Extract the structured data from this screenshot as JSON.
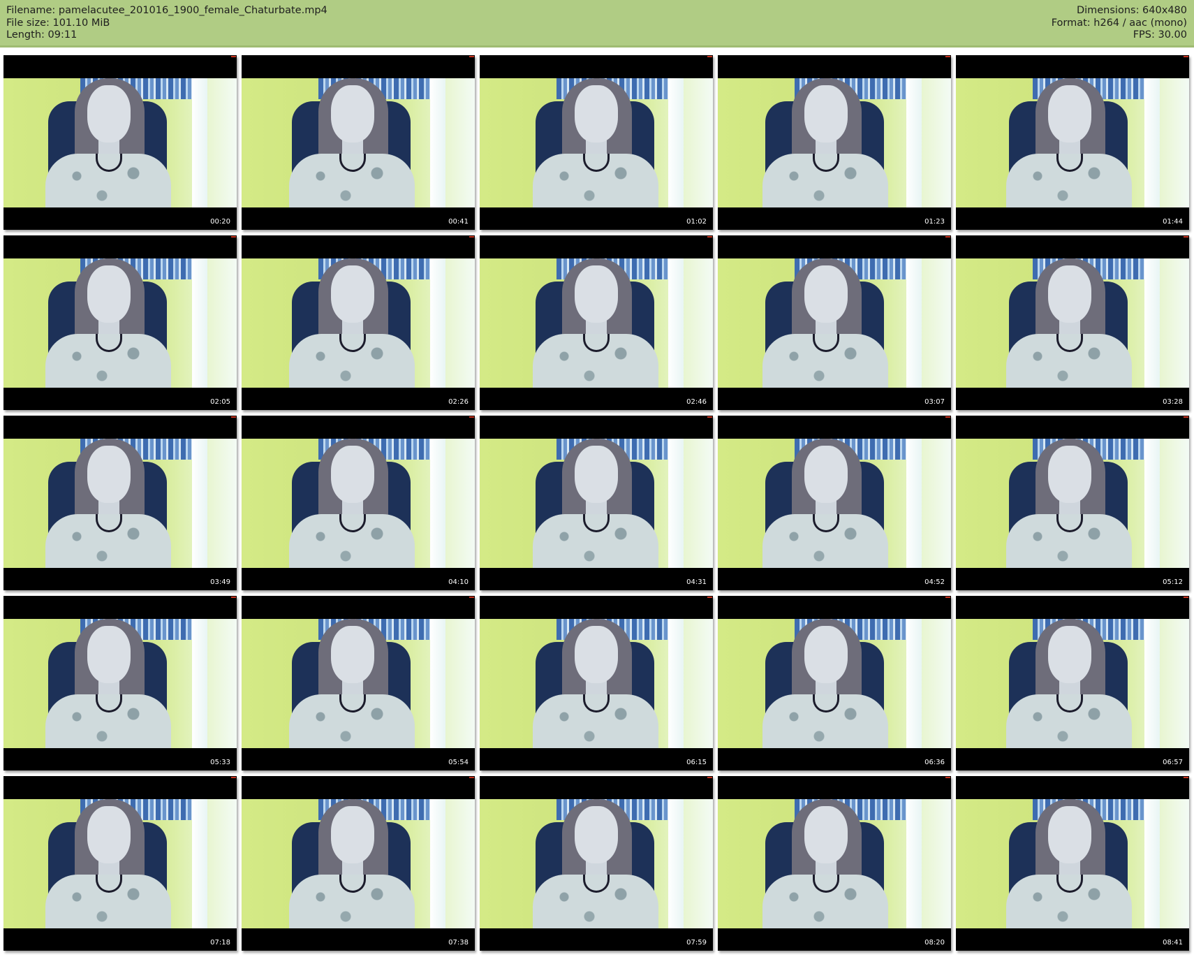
{
  "header": {
    "filename": "Filename: pamelacutee_201016_1900_female_Chaturbate.mp4",
    "filesize": "File size: 101.10 MiB",
    "length": "Length: 09:11",
    "dimensions": "Dimensions: 640x480",
    "format": "Format: h264 / aac (mono)",
    "fps": "FPS: 30.00"
  },
  "thumbnails": [
    {
      "time": "00:20"
    },
    {
      "time": "00:41"
    },
    {
      "time": "01:02"
    },
    {
      "time": "01:23"
    },
    {
      "time": "01:44"
    },
    {
      "time": "02:05"
    },
    {
      "time": "02:26"
    },
    {
      "time": "02:46"
    },
    {
      "time": "03:07"
    },
    {
      "time": "03:28"
    },
    {
      "time": "03:49"
    },
    {
      "time": "04:10"
    },
    {
      "time": "04:31"
    },
    {
      "time": "04:52"
    },
    {
      "time": "05:12"
    },
    {
      "time": "05:33"
    },
    {
      "time": "05:54"
    },
    {
      "time": "06:15"
    },
    {
      "time": "06:36"
    },
    {
      "time": "06:57"
    },
    {
      "time": "07:18"
    },
    {
      "time": "07:38"
    },
    {
      "time": "07:59"
    },
    {
      "time": "08:20"
    },
    {
      "time": "08:41"
    }
  ],
  "colors": {
    "header_bg": "#b0cc84",
    "frame_wall": "#cce27c",
    "timestamp": "#ffffff"
  }
}
